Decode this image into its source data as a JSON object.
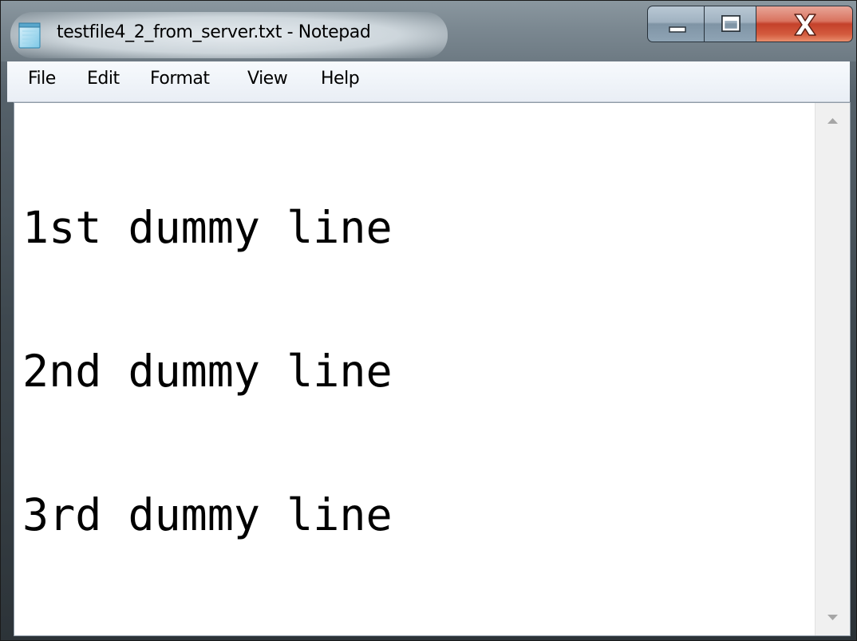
{
  "window": {
    "title": "testfile4_2_from_server.txt - Notepad",
    "icon": "notepad-icon",
    "controls": {
      "minimize_icon": "minimize-icon",
      "maximize_icon": "maximize-icon",
      "close_icon": "close-icon"
    }
  },
  "menubar": {
    "items": [
      {
        "label": "File"
      },
      {
        "label": "Edit"
      },
      {
        "label": "Format"
      },
      {
        "label": "View"
      },
      {
        "label": "Help"
      }
    ]
  },
  "editor": {
    "lines": [
      "1st dummy line",
      "2nd dummy line",
      "3rd dummy line"
    ]
  },
  "scrollbar": {
    "up_icon": "chevron-up-icon",
    "down_icon": "chevron-down-icon"
  }
}
